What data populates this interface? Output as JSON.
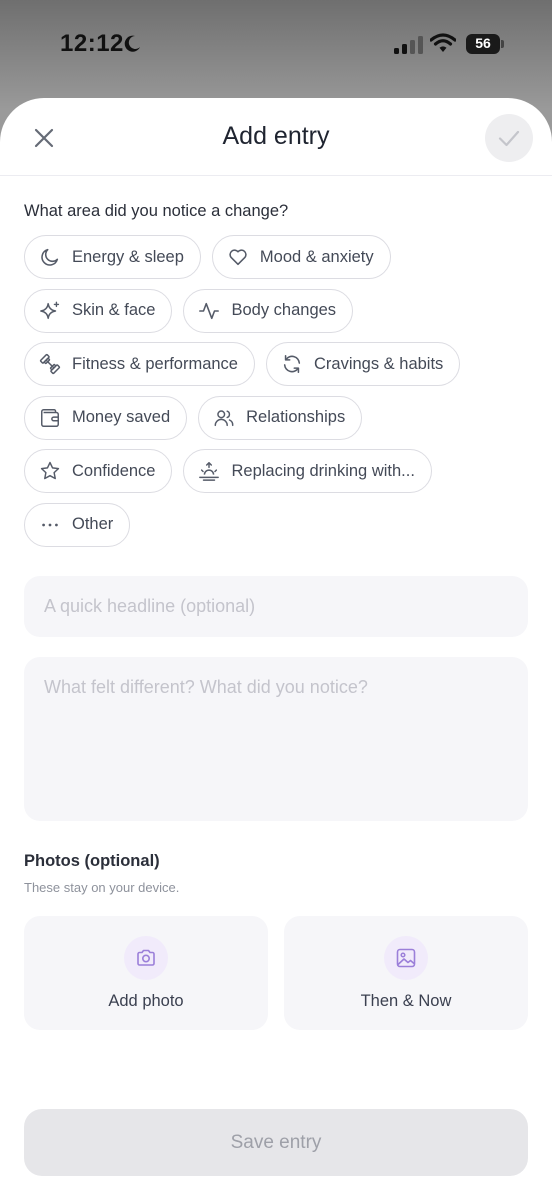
{
  "status_bar": {
    "time": "12:12",
    "battery_level": "56",
    "icons": [
      "moon-icon",
      "signal-icon",
      "wifi-icon",
      "battery-icon"
    ]
  },
  "header": {
    "title": "Add entry",
    "close_icon": "close-icon",
    "confirm_icon": "checkmark-icon"
  },
  "question": "What area did you notice a change?",
  "chip_rows": [
    [
      {
        "label": "Energy & sleep",
        "icon": "moon-icon"
      },
      {
        "label": "Mood & anxiety",
        "icon": "heart-icon"
      }
    ],
    [
      {
        "label": "Skin & face",
        "icon": "sparkles-icon"
      },
      {
        "label": "Body changes",
        "icon": "activity-icon"
      }
    ],
    [
      {
        "label": "Fitness & performance",
        "icon": "dumbbell-icon"
      },
      {
        "label": "Cravings & habits",
        "icon": "refresh-icon"
      }
    ],
    [
      {
        "label": "Money saved",
        "icon": "wallet-icon"
      },
      {
        "label": "Relationships",
        "icon": "users-icon"
      }
    ],
    [
      {
        "label": "Confidence",
        "icon": "star-icon"
      },
      {
        "label": "Replacing drinking with...",
        "icon": "sunrise-icon"
      }
    ],
    [
      {
        "label": "Other",
        "icon": "more-icon"
      }
    ]
  ],
  "headline": {
    "value": "",
    "placeholder": "A quick headline (optional)"
  },
  "body": {
    "value": "",
    "placeholder": "What felt different? What did you notice?"
  },
  "photos": {
    "title": "Photos (optional)",
    "subtitle": "These stay on your device.",
    "add_photo_label": "Add photo",
    "then_now_label": "Then & Now"
  },
  "save_label": "Save entry",
  "colors": {
    "accent_light": "#f1ebfb",
    "accent_icon": "#9b7fd9",
    "disabled_bg": "#e6e6e9",
    "disabled_text": "#9ea0a8"
  }
}
